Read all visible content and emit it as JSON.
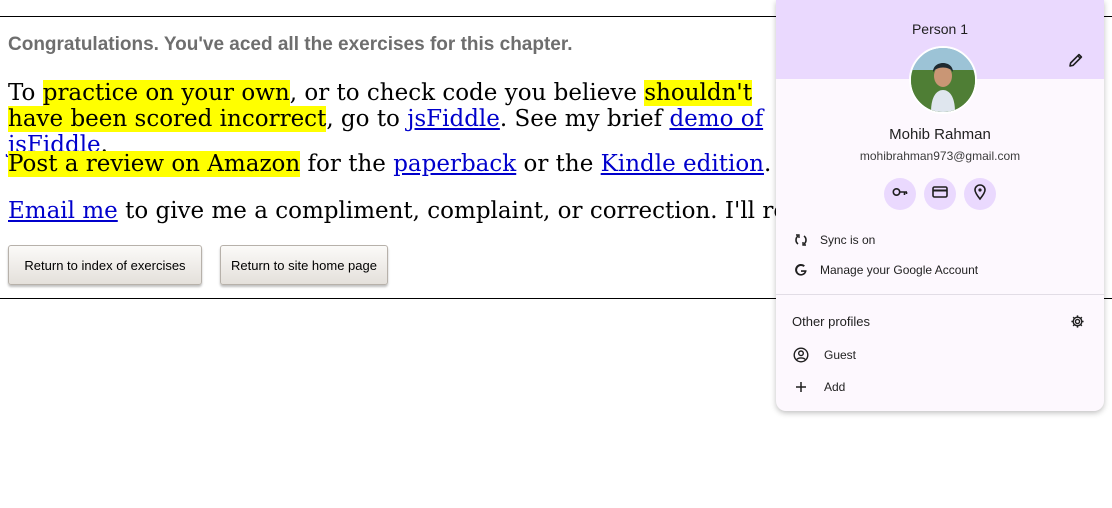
{
  "page": {
    "congrats": "Congratulations. You've aced all the exercises for this chapter.",
    "p1": {
      "t1": "To ",
      "hl1": "practice on your own",
      "t2": ", or to check code you believe ",
      "hl2": "shouldn't have been scored incorrect",
      "t3": ", go to ",
      "link1": "jsFiddle",
      "t4": ". See my brief ",
      "link2": "demo of jsFiddle",
      "t5": "."
    },
    "p2": {
      "hl": "Post a review on Amazon",
      "t1": " for the ",
      "link1": "paperback",
      "t2": " or the ",
      "link2": "Kindle edition",
      "t3": "."
    },
    "p3": {
      "link": "Email me",
      "t1": " to give me a compliment, complaint, or correction. I'll respond."
    },
    "buttons": {
      "index": "Return to index of exercises",
      "home": "Return to site home page"
    }
  },
  "profile": {
    "header": "Person 1",
    "name": "Mohib Rahman",
    "email": "mohibrahman973@gmail.com",
    "icons": [
      "pencil-icon",
      "key-icon",
      "credit-card-icon",
      "location-pin-icon",
      "sync-icon",
      "google-icon",
      "gear-icon",
      "person-circle-icon",
      "plus-icon"
    ],
    "sync": "Sync is on",
    "manage": "Manage your Google Account",
    "other_profiles": "Other profiles",
    "guest": "Guest",
    "add": "Add"
  },
  "colors": {
    "highlight": "#ffff00",
    "link": "#0000cc",
    "popup_header": "#ead9fe",
    "popup_bg": "#fdf8fe"
  }
}
